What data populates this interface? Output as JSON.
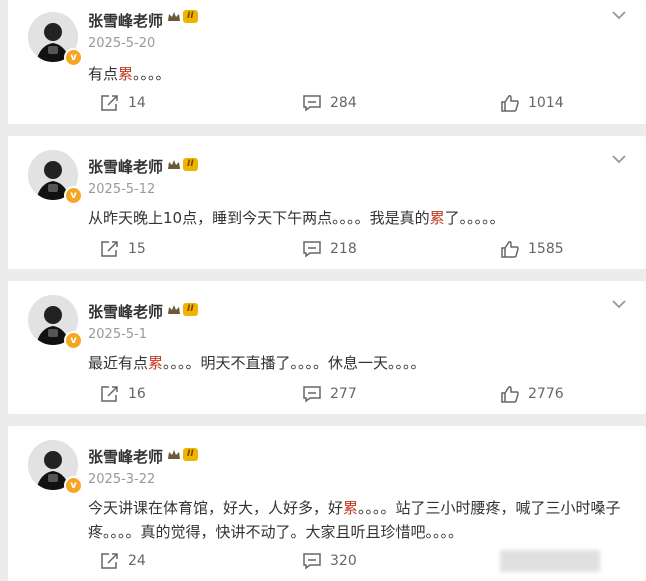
{
  "posts": [
    {
      "username": "张雪峰老师",
      "level": "II",
      "date": "2025-5-20",
      "content_parts": [
        "有点",
        "累",
        "。。。。"
      ],
      "actions": {
        "share": "14",
        "comment": "284",
        "like": "1014"
      }
    },
    {
      "username": "张雪峰老师",
      "level": "II",
      "date": "2025-5-12",
      "content_parts": [
        "从昨天晚上10点，睡到今天下午两点。。。。我是真的",
        "累",
        "了。。。。。"
      ],
      "actions": {
        "share": "15",
        "comment": "218",
        "like": "1585"
      }
    },
    {
      "username": "张雪峰老师",
      "level": "II",
      "date": "2025-5-1",
      "content_parts": [
        "最近有点",
        "累",
        "。。。。明天不直播了。。。。休息一天。。。。"
      ],
      "actions": {
        "share": "16",
        "comment": "277",
        "like": "2776"
      }
    },
    {
      "username": "张雪峰老师",
      "level": "II",
      "date": "2025-3-22",
      "content_parts": [
        "今天讲课在体育馆，好大，人好多，好",
        "累",
        "。。。。站了三小时腰疼，喊了三小时嗓子疼。。。。真的觉得，快讲不动了。大家且听且珍惜吧。。。。"
      ],
      "actions": {
        "share": "24",
        "comment": "320"
      }
    }
  ],
  "icons": {
    "share": "share-icon",
    "comment": "comment-icon",
    "like": "like-icon",
    "more": "chevron-down-icon",
    "verified": "verified-icon",
    "crown": "crown-icon"
  },
  "colors": {
    "highlight": "#c23b22",
    "level_badge": "#f0b400",
    "verified_badge": "#f5a623"
  }
}
